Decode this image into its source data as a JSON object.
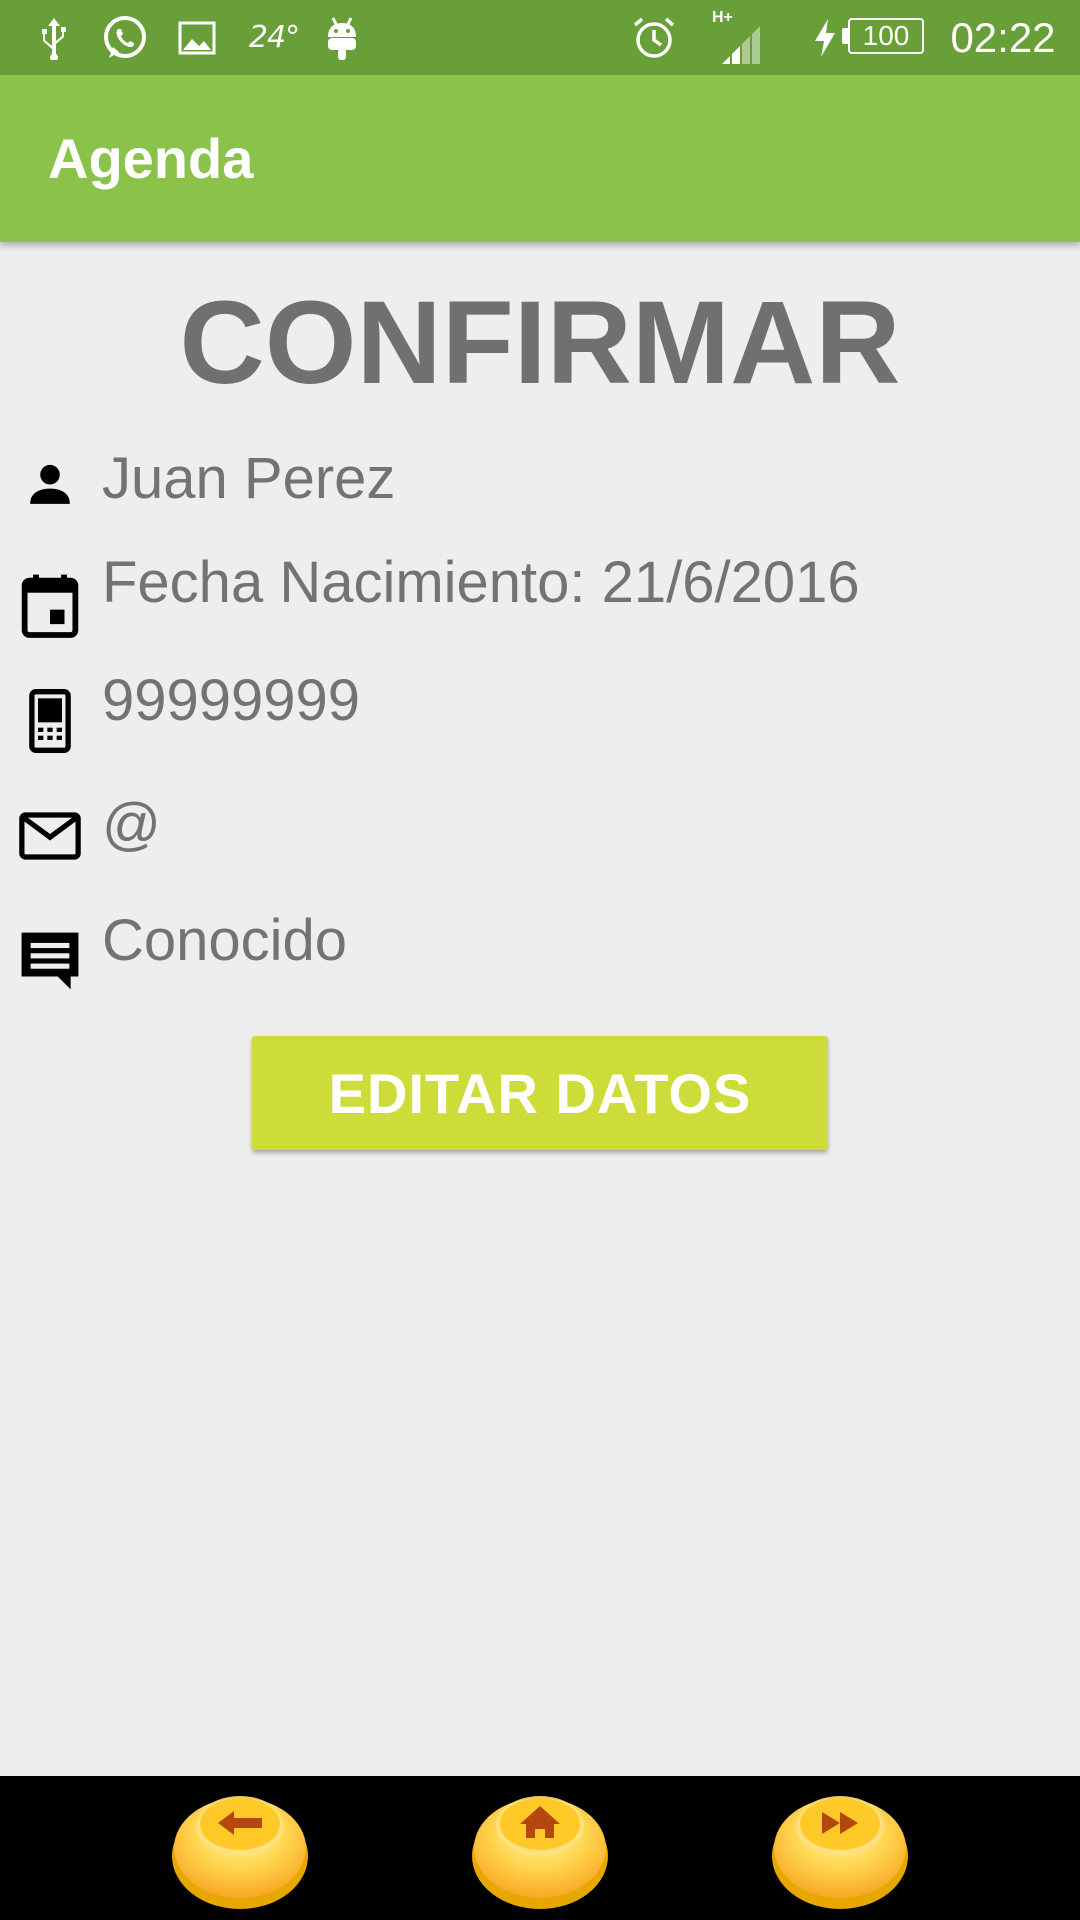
{
  "status_bar": {
    "temperature": "24°",
    "network": "H+",
    "battery": "100",
    "time": "02:22",
    "icons": [
      "usb-icon",
      "whatsapp-icon",
      "image-icon",
      "android-icon",
      "alarm-icon",
      "signal-icon",
      "charging-icon",
      "battery-icon"
    ]
  },
  "app_bar": {
    "title": "Agenda"
  },
  "main": {
    "heading": "CONFIRMAR",
    "fields": [
      {
        "icon": "person-icon",
        "value": "Juan Perez"
      },
      {
        "icon": "calendar-icon",
        "value": "Fecha Nacimiento: 21/6/2016"
      },
      {
        "icon": "phone-icon",
        "value": "99999999"
      },
      {
        "icon": "mail-icon",
        "value": "@"
      },
      {
        "icon": "comment-icon",
        "value": "Conocido"
      }
    ],
    "edit_button_label": "EDITAR DATOS"
  },
  "bottom_nav": {
    "buttons": [
      "back-arrow-icon",
      "home-icon",
      "fast-forward-icon"
    ]
  },
  "colors": {
    "status_bar": "#689f38",
    "app_bar": "#8bc34a",
    "background": "#eeeeee",
    "text": "#737373",
    "button": "#cddc39",
    "nav_button": "#ffc107"
  }
}
